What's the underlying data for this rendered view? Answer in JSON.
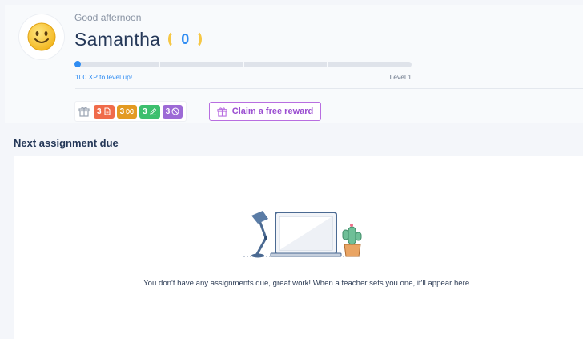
{
  "header": {
    "greeting": "Good afternoon",
    "name": "Samantha",
    "coins": "0",
    "avatar_icon": "smiley-face-icon",
    "progress": {
      "fraction": 0.0,
      "xp_label": "100 XP to level up!",
      "level_label": "Level 1"
    }
  },
  "badges": {
    "icon": "gift-icon",
    "items": [
      {
        "value": "3",
        "icon": "document-icon",
        "color": "#f06b4a"
      },
      {
        "value": "3",
        "icon": "butterfly-icon",
        "color": "#e39a22"
      },
      {
        "value": "3",
        "icon": "pencil-icon",
        "color": "#3dbf6e"
      },
      {
        "value": "3",
        "icon": "clock-icon",
        "color": "#9d6ad6"
      }
    ]
  },
  "claim": {
    "label": "Claim a free reward",
    "icon": "gift-icon",
    "color": "#9b4fd1"
  },
  "assignments": {
    "title": "Next assignment due",
    "illustration": "desk-laptop-illustration",
    "empty_message": "You don't have any assignments due, great work! When a teacher sets you one, it'll appear here."
  },
  "colors": {
    "accent": "#2f8cf2",
    "coin": "#f6c744",
    "text_dark": "#253858"
  }
}
